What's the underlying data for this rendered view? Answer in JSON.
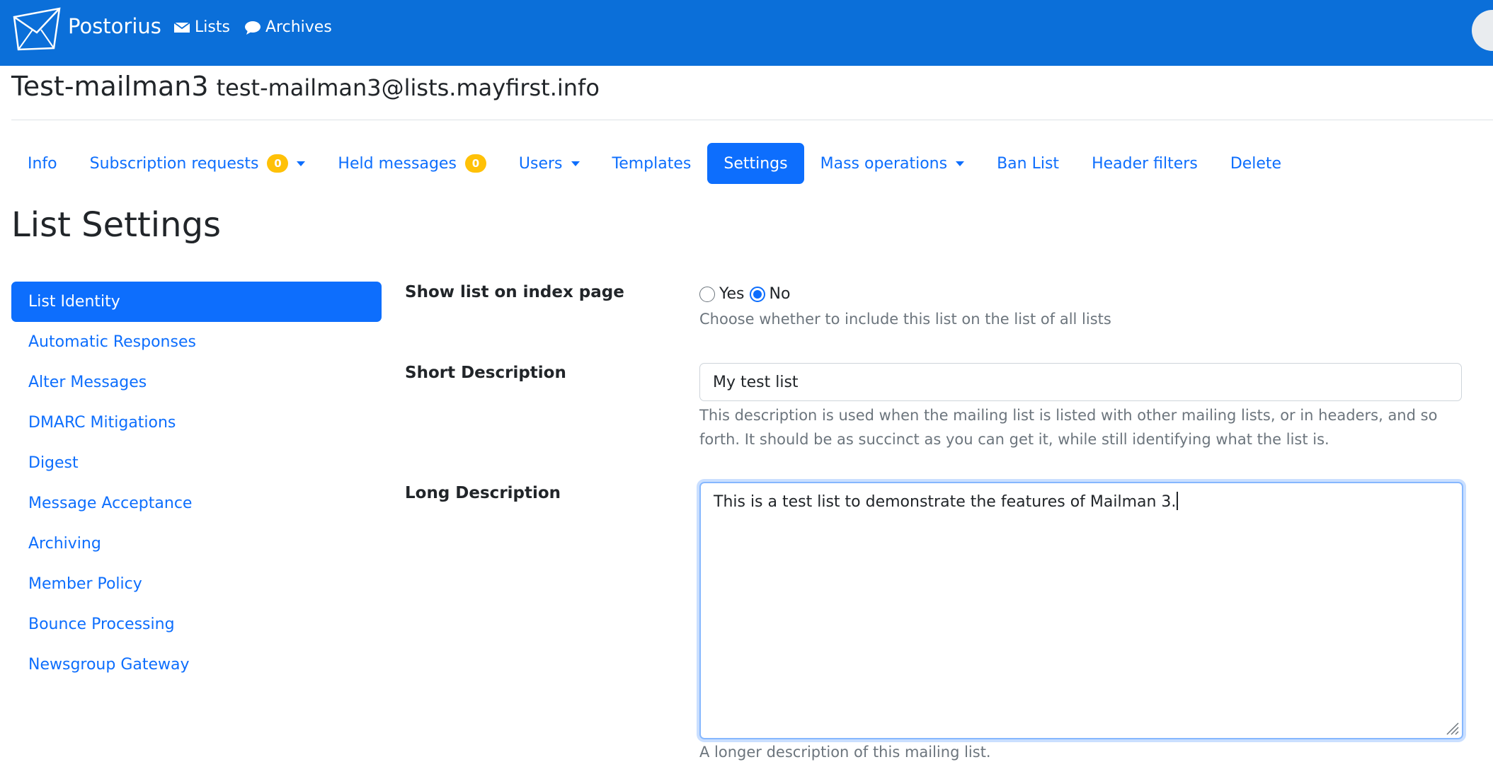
{
  "navbar": {
    "brand": "Postorius",
    "links": [
      {
        "label": "Lists",
        "icon": "envelope-icon"
      },
      {
        "label": "Archives",
        "icon": "comment-icon"
      }
    ],
    "background": "#0b6fd9"
  },
  "list": {
    "name": "Test-mailman3",
    "address": "test-mailman3@lists.mayfirst.info"
  },
  "tabs": [
    {
      "label": "Info"
    },
    {
      "label": "Subscription requests",
      "badge": "0",
      "dropdown": true
    },
    {
      "label": "Held messages",
      "badge": "0"
    },
    {
      "label": "Users",
      "dropdown": true
    },
    {
      "label": "Templates"
    },
    {
      "label": "Settings",
      "active": true
    },
    {
      "label": "Mass operations",
      "dropdown": true
    },
    {
      "label": "Ban List"
    },
    {
      "label": "Header filters"
    },
    {
      "label": "Delete"
    }
  ],
  "page_title": "List Settings",
  "sidebar": {
    "items": [
      {
        "label": "List Identity",
        "active": true
      },
      {
        "label": "Automatic Responses"
      },
      {
        "label": "Alter Messages"
      },
      {
        "label": "DMARC Mitigations"
      },
      {
        "label": "Digest"
      },
      {
        "label": "Message Acceptance"
      },
      {
        "label": "Archiving"
      },
      {
        "label": "Member Policy"
      },
      {
        "label": "Bounce Processing"
      },
      {
        "label": "Newsgroup Gateway"
      }
    ]
  },
  "form": {
    "show_on_index": {
      "label": "Show list on index page",
      "options": [
        "Yes",
        "No"
      ],
      "selected": "No",
      "help": "Choose whether to include this list on the list of all lists"
    },
    "short_description": {
      "label": "Short Description",
      "value": "My test list",
      "help_line1": "This description is used when the mailing list is listed with other mailing lists, or in headers, and so",
      "help_line2": "forth. It should be as succinct as you can get it, while still identifying what the list is."
    },
    "long_description": {
      "label": "Long Description",
      "value": "This is a test list to demonstrate the features of Mailman 3.",
      "help": "A longer description of this mailing list."
    }
  },
  "colors": {
    "primary": "#0d6efd",
    "badge": "#ffc107",
    "muted": "#6c757d"
  }
}
